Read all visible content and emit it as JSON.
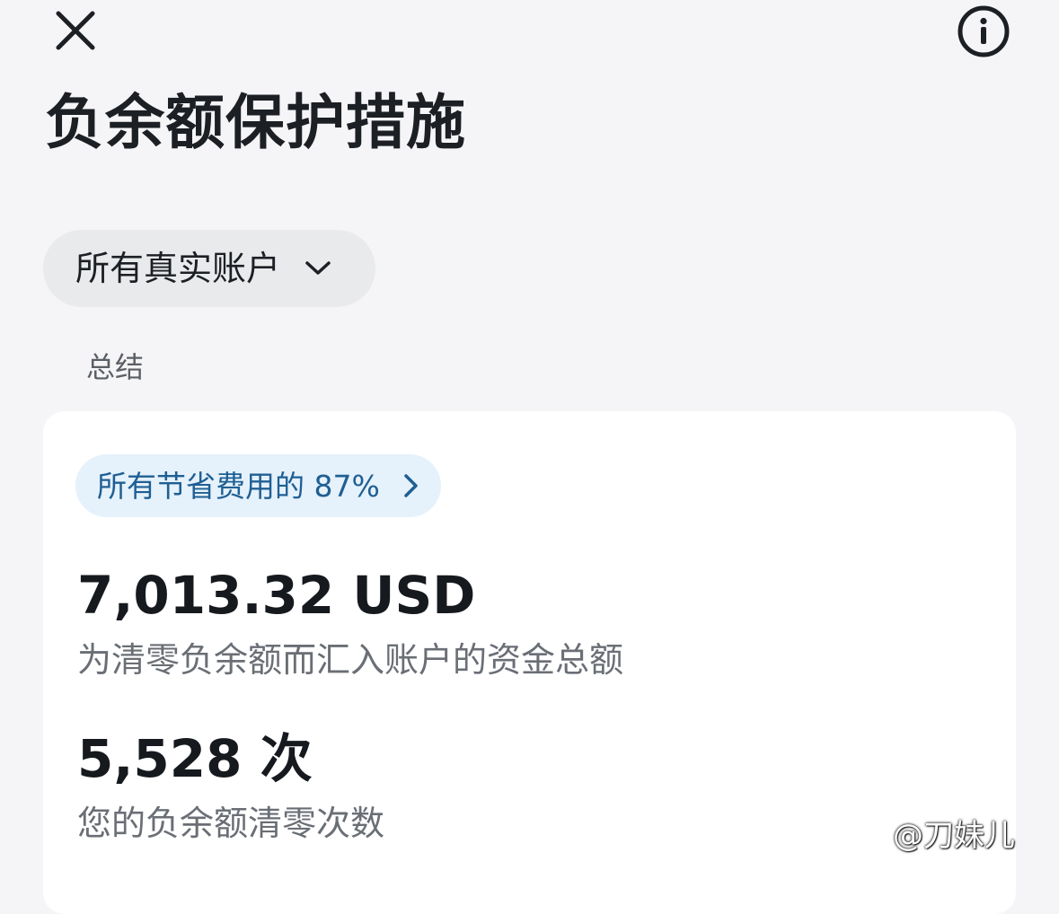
{
  "header": {
    "close_icon": "close-icon",
    "info_icon": "info-icon",
    "title": "负余额保护措施"
  },
  "account_filter": {
    "selected": "所有真实账户",
    "icon": "chevron-down-icon"
  },
  "summary": {
    "section_label": "总结",
    "savings_badge": "所有节省费用的 87%",
    "savings_icon": "chevron-right-icon",
    "metrics": [
      {
        "value": "7,013.32 USD",
        "description": "为清零负余额而汇入账户的资金总额"
      },
      {
        "value": "5,528 次",
        "description": "您的负余额清零次数"
      }
    ]
  },
  "watermark": "@刀妹儿",
  "colors": {
    "background": "#f5f5f7",
    "card": "#ffffff",
    "pill": "#e9eaec",
    "savings_pill": "#e5f1fb",
    "savings_text": "#1f5f93",
    "text_primary": "#1c1f24",
    "text_secondary": "#6a6e75"
  }
}
